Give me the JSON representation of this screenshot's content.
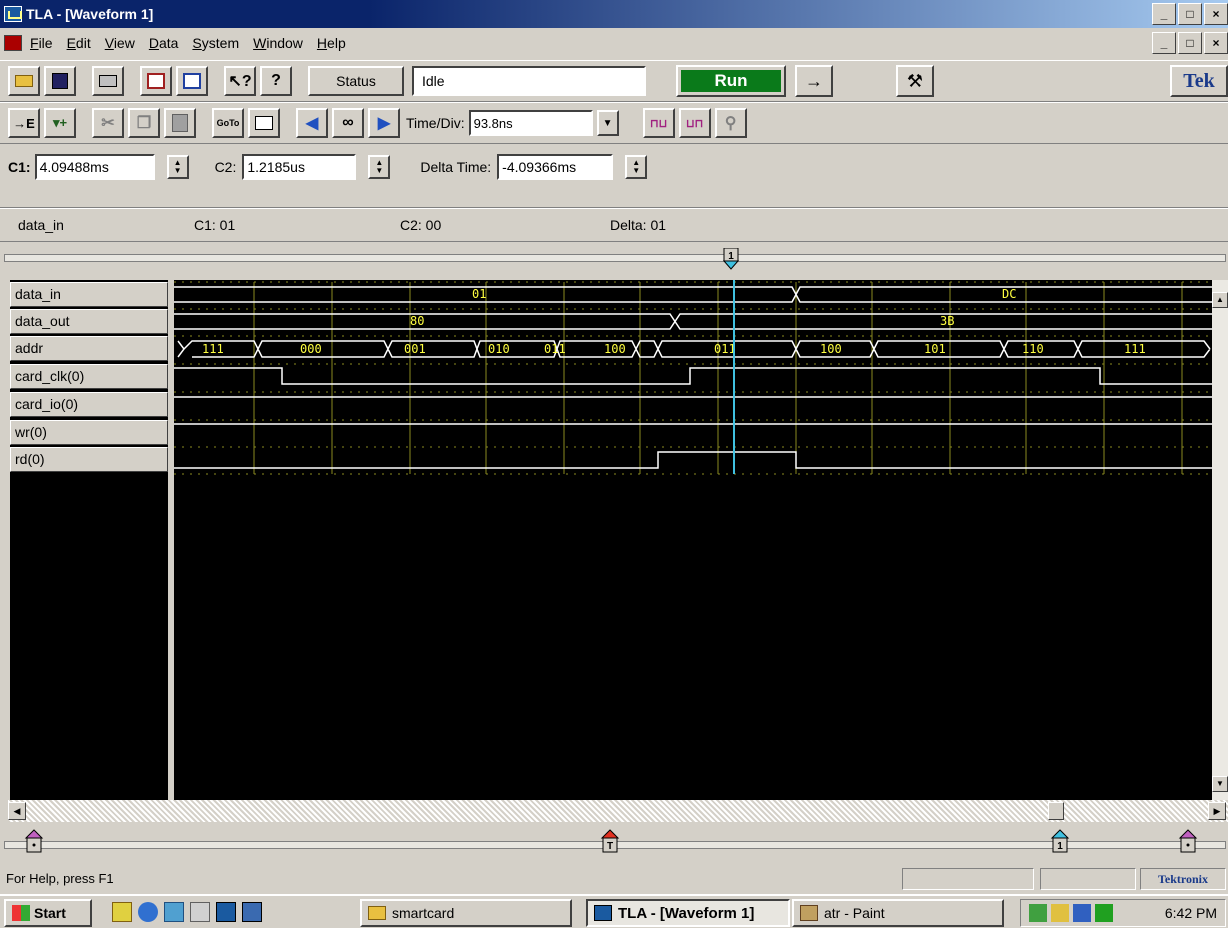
{
  "window": {
    "title": "TLA - [Waveform 1]",
    "controls": [
      "_",
      "□",
      "×"
    ]
  },
  "menu": {
    "items": [
      {
        "label": "File",
        "accel": "F",
        "rest": "ile"
      },
      {
        "label": "Edit",
        "accel": "E",
        "rest": "dit"
      },
      {
        "label": "View",
        "accel": "V",
        "rest": "iew"
      },
      {
        "label": "Data",
        "accel": "D",
        "rest": "ata"
      },
      {
        "label": "System",
        "accel": "S",
        "rest": "ystem"
      },
      {
        "label": "Window",
        "accel": "W",
        "rest": "indow"
      },
      {
        "label": "Help",
        "accel": "H",
        "rest": "elp"
      }
    ]
  },
  "toolbar": {
    "status_label": "Status",
    "status_value": "Idle",
    "run_label": "Run",
    "arrow_label": "→",
    "brand": "Tek",
    "timediv_label": "Time/Div:",
    "timediv_value": "93.8ns"
  },
  "cursors": {
    "c1_label": "C1:",
    "c1_value": "4.09488ms",
    "c2_label": "C2:",
    "c2_value": "1.2185us",
    "delta_label": "Delta Time:",
    "delta_value": "-4.09366ms"
  },
  "info": {
    "signal": "data_in",
    "c1": "C1: 01",
    "c2": "C2: 00",
    "delta": "Delta: 01"
  },
  "signals": [
    "data_in",
    "data_out",
    "addr",
    "card_clk(0)",
    "card_io(0)",
    "wr(0)",
    "rd(0)"
  ],
  "waveform": {
    "data_in_values": [
      "01",
      "DC"
    ],
    "data_out_values": [
      "80",
      "3B"
    ],
    "addr_values": [
      "111",
      "000",
      "001",
      "010",
      "011",
      "100",
      "011",
      "100",
      "101",
      "110",
      "111"
    ],
    "cursor_marker": "1",
    "colors": {
      "trace": "#ffffff",
      "bus_text": "#ffff40",
      "grid": "#8a8a20",
      "cursor": "#40c0e0"
    }
  },
  "status": {
    "help_text": "For Help, press F1",
    "brand": "Tektronix"
  },
  "taskbar": {
    "start": "Start",
    "tasks": [
      "smartcard",
      "TLA - [Waveform 1]",
      "atr - Paint"
    ],
    "clock": "6:42 PM"
  }
}
